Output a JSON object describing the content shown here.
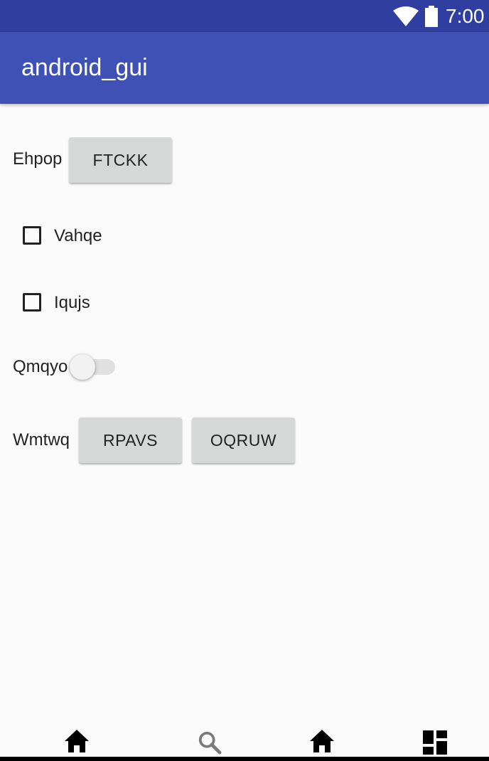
{
  "status_bar": {
    "time": "7:00",
    "icons": [
      "wifi-icon",
      "battery-icon"
    ],
    "color": "#303f9f"
  },
  "app_bar": {
    "title": "android_gui",
    "color": "#3f51b5"
  },
  "rows": {
    "row1": {
      "label": "Ehpop",
      "button": "FTCKK"
    },
    "checkbox1": {
      "label": "Vahqe",
      "checked": false
    },
    "checkbox2": {
      "label": "Iqujs",
      "checked": false
    },
    "switch_row": {
      "label": "Qmqyo",
      "on": false
    },
    "row5": {
      "label": "Wmtwq",
      "buttons": [
        "RPAVS",
        "OQRUW"
      ]
    }
  },
  "bottom_nav": {
    "items": [
      {
        "icon": "home-icon"
      },
      {
        "icon": "search-icon"
      },
      {
        "icon": "home-icon"
      },
      {
        "icon": "dashboard-icon"
      }
    ]
  }
}
